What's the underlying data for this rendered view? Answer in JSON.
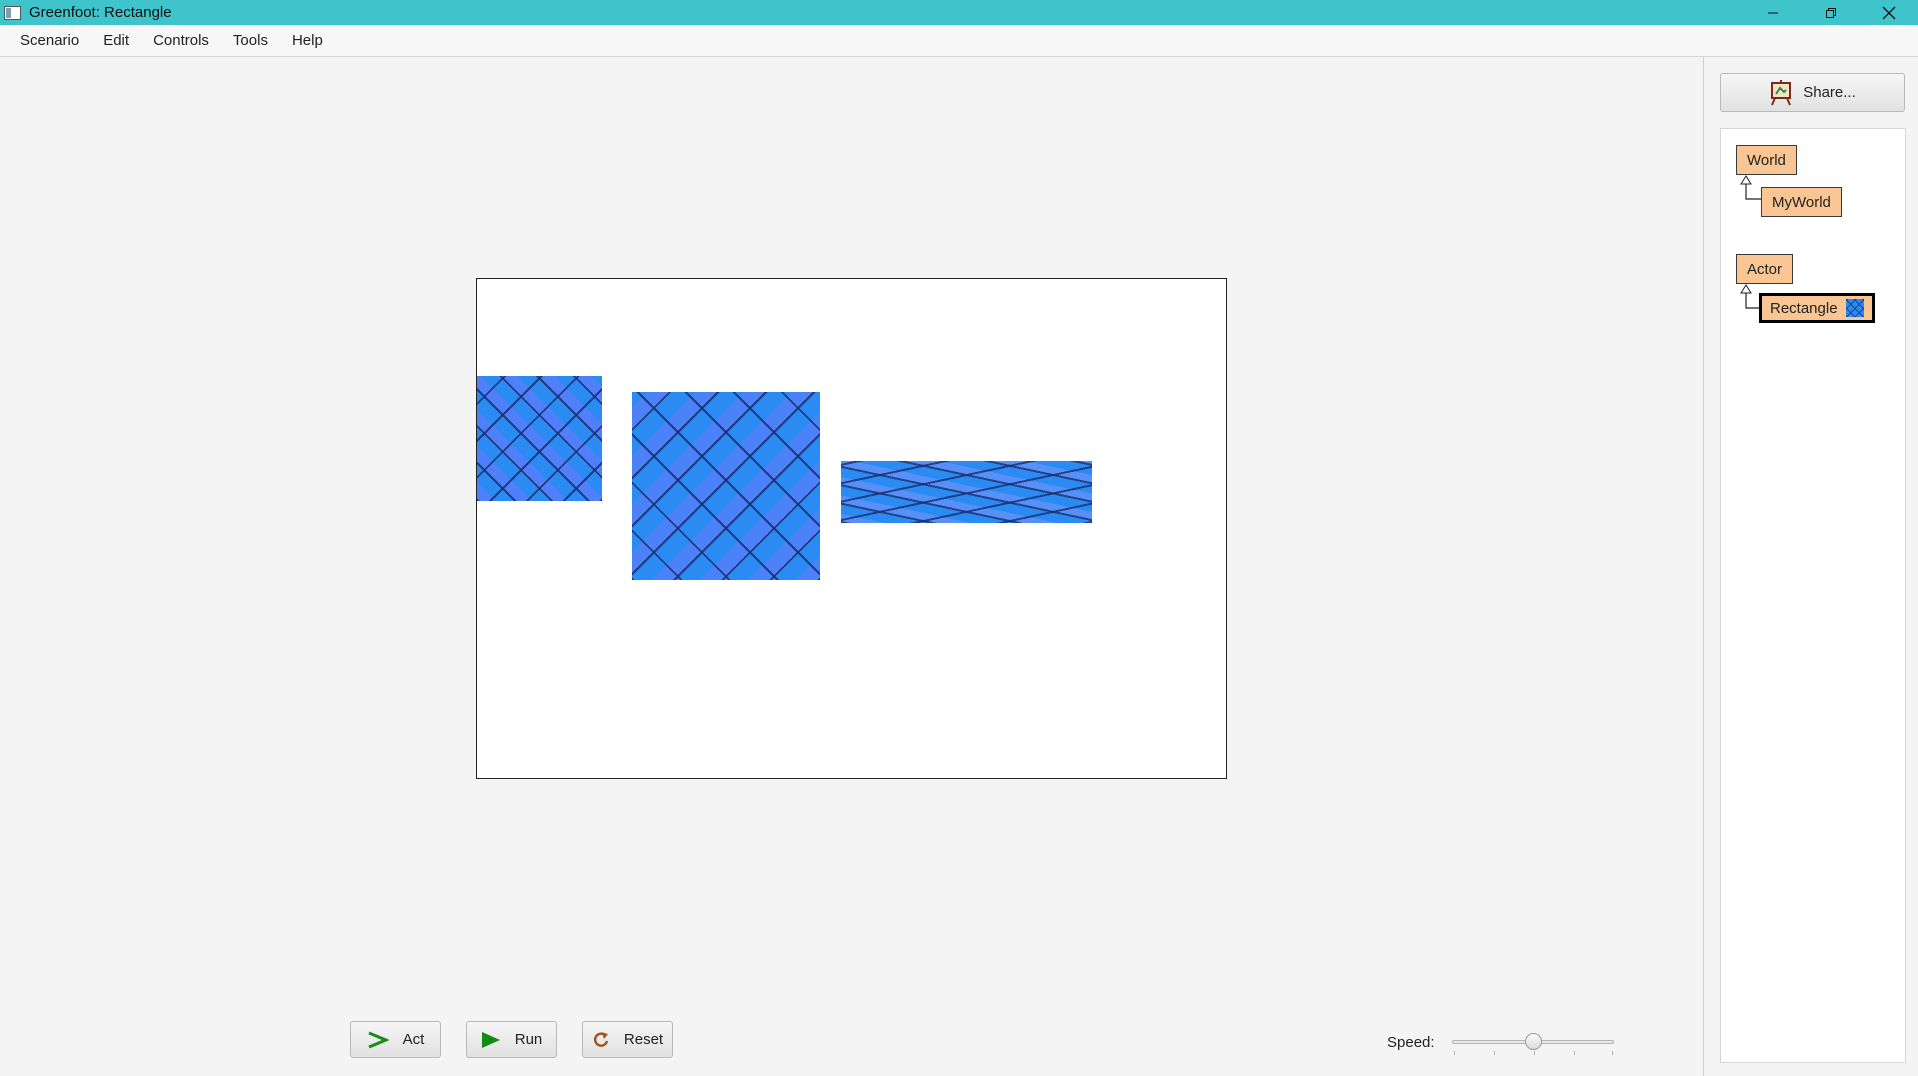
{
  "window": {
    "title": "Greenfoot: Rectangle",
    "controls": [
      "minimize-icon",
      "restore-icon",
      "close-icon"
    ],
    "titlebar_color": "#40c4cc"
  },
  "menu": {
    "items": [
      "Scenario",
      "Edit",
      "Controls",
      "Tools",
      "Help"
    ]
  },
  "world": {
    "background": "#ffffff",
    "actors": [
      {
        "name": "rectangle-actor-1",
        "fill": "#2a8bf2",
        "pattern": "diamond-plaid"
      },
      {
        "name": "rectangle-actor-2",
        "fill": "#2a8bf2",
        "pattern": "diamond-plaid"
      },
      {
        "name": "rectangle-actor-3",
        "fill": "#2a8bf2",
        "pattern": "diamond-plaid-stretched"
      }
    ]
  },
  "share": {
    "label": "Share...",
    "icon": "share-easel-icon"
  },
  "class_tree": {
    "world_class": "World",
    "world_subclass": "MyWorld",
    "actor_class": "Actor",
    "actor_subclass": "Rectangle",
    "selected": "Rectangle",
    "class_color": "#f9c592"
  },
  "controls": {
    "act_label": "Act",
    "run_label": "Run",
    "reset_label": "Reset",
    "speed_label": "Speed:",
    "speed_value": 0.5
  }
}
